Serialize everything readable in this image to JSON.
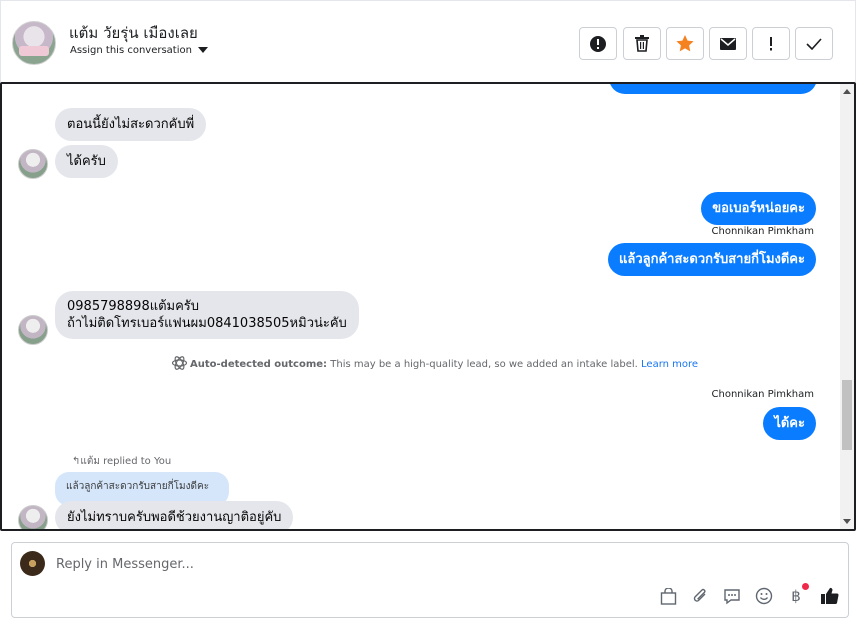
{
  "header": {
    "contact_name": "แต้ม วัยรุ่น เมืองเลย",
    "assign_label": "Assign this conversation",
    "actions": [
      "mark-spam",
      "delete",
      "star",
      "mark-unread",
      "important",
      "done"
    ]
  },
  "messages": {
    "m1": "ตอนนี้ยังไม่สะดวกคับพี่",
    "m2": "ได้ครับ",
    "m3": "ขอเบอร์หน่อยคะ",
    "m3_sender": "Chonnikan Pimkham",
    "m4": "แล้วลูกค้าสะดวกรับสายกี่โมงดีคะ",
    "m5_line1": "0985798898แต้มครับ",
    "m5_line2": "ถ้าไม่ติดโทรเบอร์แฟนผม0841038505หมิวน่ะคับ",
    "auto_title": "Auto-detected outcome:",
    "auto_text": "This may be a high-quality lead, so we added an intake label.",
    "auto_link": "Learn more",
    "m6_sender": "Chonnikan Pimkham",
    "m6": "ได้คะ",
    "reply_meta": "แต้ม replied to You",
    "quoted": "แล้วลูกค้าสะดวกรับสายกี่โมงดีคะ",
    "m7": "ยังไม่ทราบครับพอดีช้วยงานญาติอยู่คับ"
  },
  "composer": {
    "placeholder": "Reply in Messenger...",
    "tools": [
      "bag-icon",
      "attach-icon",
      "saved-reply-icon",
      "emoji-icon",
      "baht-icon",
      "like-icon"
    ]
  },
  "colors": {
    "outgoing": "#0a7cff",
    "incoming": "#e4e6eb",
    "star": "#f5821f"
  }
}
